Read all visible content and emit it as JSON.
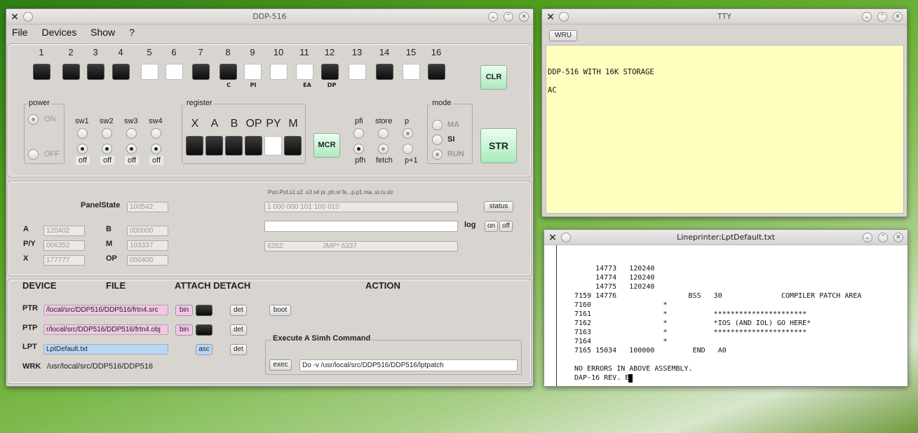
{
  "ddp": {
    "title": "DDP-516",
    "menu": [
      "File",
      "Devices",
      "Show",
      "?"
    ],
    "bit_numbers": [
      "1",
      "2",
      "3",
      "4",
      "5",
      "6",
      "7",
      "8",
      "9",
      "10",
      "11",
      "12",
      "13",
      "14",
      "15",
      "16"
    ],
    "bit_states": [
      1,
      1,
      1,
      1,
      0,
      0,
      1,
      1,
      0,
      0,
      0,
      1,
      0,
      1,
      0,
      1
    ],
    "bit_labels": {
      "c": "C",
      "pi": "PI",
      "ea": "EA",
      "dp": "DP"
    },
    "clr": "CLR",
    "str": "STR",
    "mcr": "MCR",
    "power": {
      "title": "power",
      "on": "ON",
      "off": "OFF"
    },
    "sense": {
      "labels": [
        "sw1",
        "sw2",
        "sw3",
        "sw4"
      ],
      "off": "off"
    },
    "register": {
      "title": "register",
      "labels": [
        "X",
        "A",
        "B",
        "OP",
        "PY",
        "M"
      ],
      "states": [
        1,
        1,
        1,
        1,
        0,
        1
      ]
    },
    "pfi": {
      "pfi": "pfi",
      "store": "store",
      "p": "p",
      "pfh": "pfh",
      "fetch": "fetch",
      "p1": "p+1"
    },
    "mode": {
      "title": "mode",
      "ma": "MA",
      "si": "SI",
      "run": "RUN"
    }
  },
  "state": {
    "panelstate_label": "PanelState",
    "panelstate": "100542",
    "bits_header": "Pon.Pof.s1.s2..s3 s4 pi..ph.st fe...p.p1.ma..si.ru.str",
    "bits_value": "1  000  000  101  100  010",
    "status": "status",
    "log": "log",
    "on": "on",
    "off": "off",
    "instr": "6352:",
    "instr_text": "JMP* 6337",
    "regs": {
      "a_l": "A",
      "a": "120402",
      "b_l": "B",
      "b": "000000",
      "py_l": "P/Y",
      "py": "006352",
      "m_l": "M",
      "m": "103337",
      "x_l": "X",
      "x": "177777",
      "op_l": "OP",
      "op": "000400"
    }
  },
  "devices": {
    "headers": {
      "device": "DEVICE",
      "file": "FILE",
      "attach": "ATTACH DETACH",
      "action": "ACTION"
    },
    "ptr": {
      "name": "PTR",
      "file": "/local/src/DDP516/DDP516/frtn4.src",
      "mode": "bin",
      "det": "det",
      "boot": "boot"
    },
    "ptp": {
      "name": "PTP",
      "file": "r/local/src/DDP516/DDP516/frtn4.obj",
      "mode": "bin",
      "det": "det"
    },
    "lpt": {
      "name": "LPT",
      "file": "LptDefault.txt",
      "mode": "asc",
      "det": "det"
    },
    "wrk": {
      "name": "WRK",
      "path": "/usr/local/src/DDP516/DDP516"
    },
    "simh": {
      "title": "Execute A Simh Command",
      "exec": "exec",
      "command": "Do -v /usr/local/src/DDP516/DDP516/lptpatch"
    }
  },
  "tty": {
    "title": "TTY",
    "wru": "WRU",
    "lines": [
      "",
      "",
      "DDP-516 WITH  16K STORAGE",
      "",
      "AC"
    ]
  },
  "lpt": {
    "title": "Lineprinter:LptDefault.txt",
    "lines": [
      "     14773   120240",
      "     14774   120240",
      "     14775   120240",
      "7159 14776                 BSS   30              COMPILER PATCH AREA",
      "7160                 *",
      "7161                 *           **********************",
      "7162                 *           *IOS (AND IOL) GO HERE*",
      "7163                 *           **********************",
      "7164                 *",
      "7165 15034   100000         END   A0",
      "",
      "NO ERRORS IN ABOVE ASSEMBLY.",
      "DAP-16 REV. E"
    ]
  },
  "colors": {
    "pink": "#f4c6e6",
    "blue": "#b9d8f8",
    "green": "#b8eec8",
    "tty_bg": "#ffffc0"
  }
}
